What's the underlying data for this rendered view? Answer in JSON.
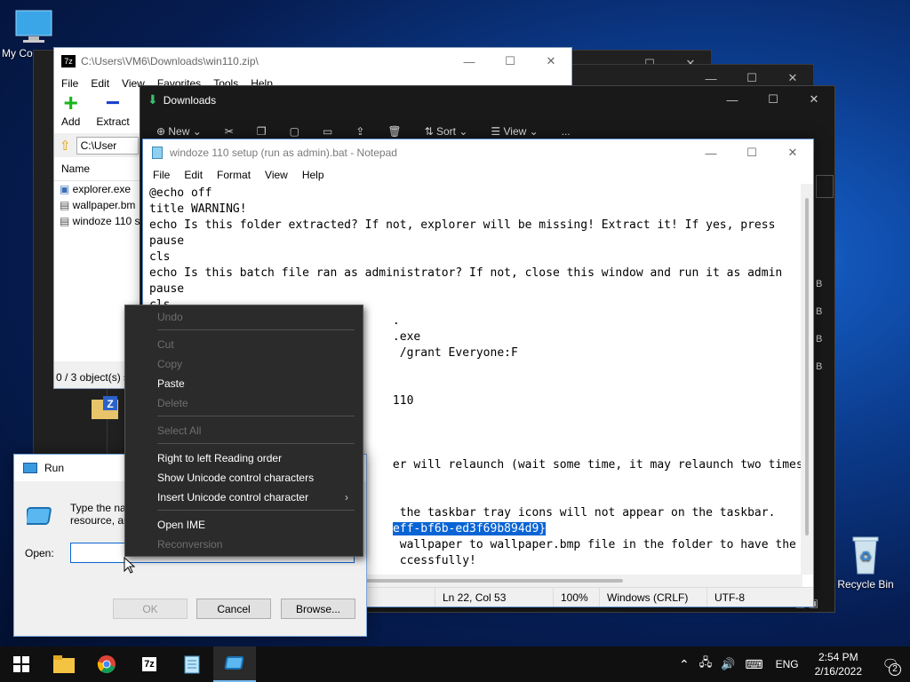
{
  "desktop": {
    "my_computer_label": "My Co",
    "recycle_bin_label": "Recycle Bin"
  },
  "sevenzip": {
    "title": "C:\\Users\\VM6\\Downloads\\win110.zip\\",
    "menu": [
      "File",
      "Edit",
      "View",
      "Favorites",
      "Tools",
      "Help"
    ],
    "add_label": "Add",
    "extract_label": "Extract",
    "path": "C:\\User",
    "column_name": "Name",
    "files": [
      "explorer.exe",
      "wallpaper.bm",
      "windoze 110 s"
    ],
    "status": "0 / 3 object(s) s"
  },
  "downloads": {
    "title": "Downloads",
    "new_label": "New",
    "sort_label": "Sort",
    "view_label": "View",
    "more_label": "..."
  },
  "notepad": {
    "title": "windoze 110 setup (run as admin).bat - Notepad",
    "menu": [
      "File",
      "Edit",
      "Format",
      "View",
      "Help"
    ],
    "lines": [
      "@echo off",
      "title WARNING!",
      "echo Is this folder extracted? If not, explorer will be missing! Extract it! If yes, press",
      "pause",
      "cls",
      "echo Is this batch file ran as administrator? If not, close this window and run it as admin",
      "pause",
      "cls",
      "                                   .",
      "                                   .exe",
      "                                    /grant Everyone:F",
      "",
      "",
      "                                   110",
      "",
      "",
      "",
      "                                   er will relaunch (wait some time, it may relaunch two times)",
      "",
      "",
      "                                    the taskbar tray icons will not appear on the taskbar.",
      "                                   eff-bf6b-ed3f69b894d9}",
      "                                    wallpaper to wallpaper.bmp file in the folder to have the WI",
      "                                    ccessfully!"
    ],
    "selection_text": "eff-bf6b-ed3f69b894d9}",
    "status": {
      "position": "Ln 22, Col 53",
      "zoom": "100%",
      "eol": "Windows (CRLF)",
      "encoding": "UTF-8"
    }
  },
  "run_dialog": {
    "title": "Run",
    "description_line1": "Type the na",
    "description_line2": "resource, an",
    "open_label": "Open:",
    "open_value": "",
    "ok_label": "OK",
    "cancel_label": "Cancel",
    "browse_label": "Browse..."
  },
  "context_menu": {
    "undo": "Undo",
    "cut": "Cut",
    "copy": "Copy",
    "paste": "Paste",
    "delete": "Delete",
    "select_all": "Select All",
    "rtl": "Right to left Reading order",
    "show_unicode": "Show Unicode control characters",
    "insert_unicode": "Insert Unicode control character",
    "open_ime": "Open IME",
    "reconversion": "Reconversion"
  },
  "taskbar": {
    "language": "ENG",
    "time": "2:54 PM",
    "date": "2/16/2022",
    "notification_count": "2"
  },
  "colors": {
    "selection": "#0a64d4",
    "accent": "#76b9ed"
  }
}
